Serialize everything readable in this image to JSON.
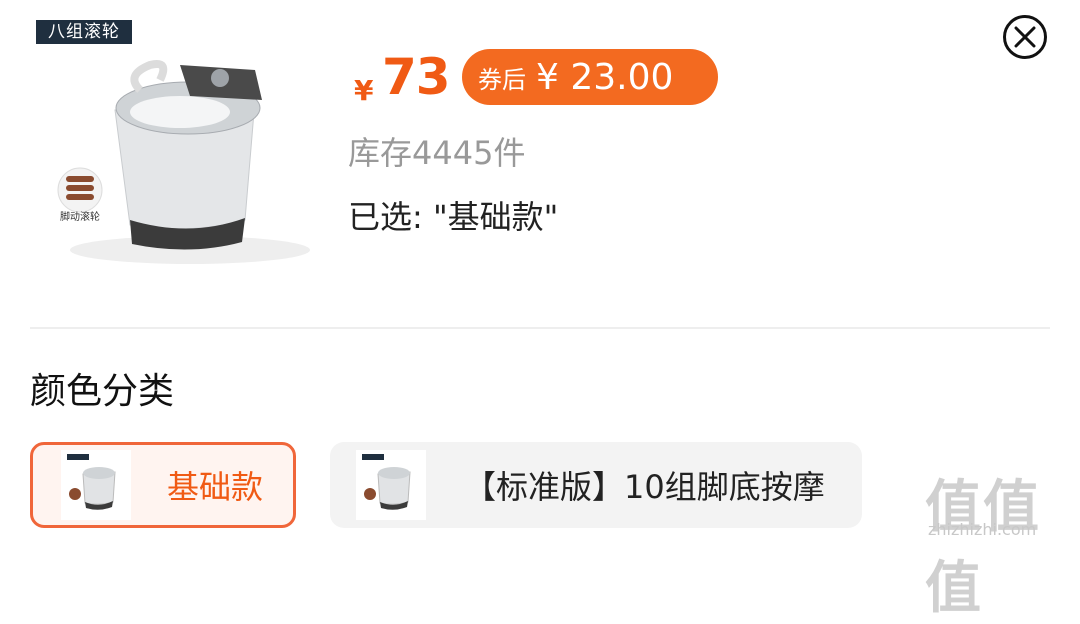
{
  "product": {
    "badge": "八组滚轮",
    "roller_caption": "脚动滚轮"
  },
  "price": {
    "symbol": "¥",
    "value": "73",
    "coupon_label": "券后",
    "coupon_price": "¥ 23.00"
  },
  "stock_text": "库存4445件",
  "selected_text": "已选: \"基础款\"",
  "section": {
    "title": "颜色分类"
  },
  "options": [
    {
      "label": "基础款",
      "selected": true
    },
    {
      "label": "【标准版】10组脚底按摩",
      "selected": false
    }
  ],
  "watermark": {
    "text": "值值值",
    "url": "zhizhizhi.com"
  },
  "colors": {
    "accent": "#f05a14",
    "coupon_bg": "#f36a20"
  },
  "icons": {
    "close": "close-circle-icon"
  }
}
